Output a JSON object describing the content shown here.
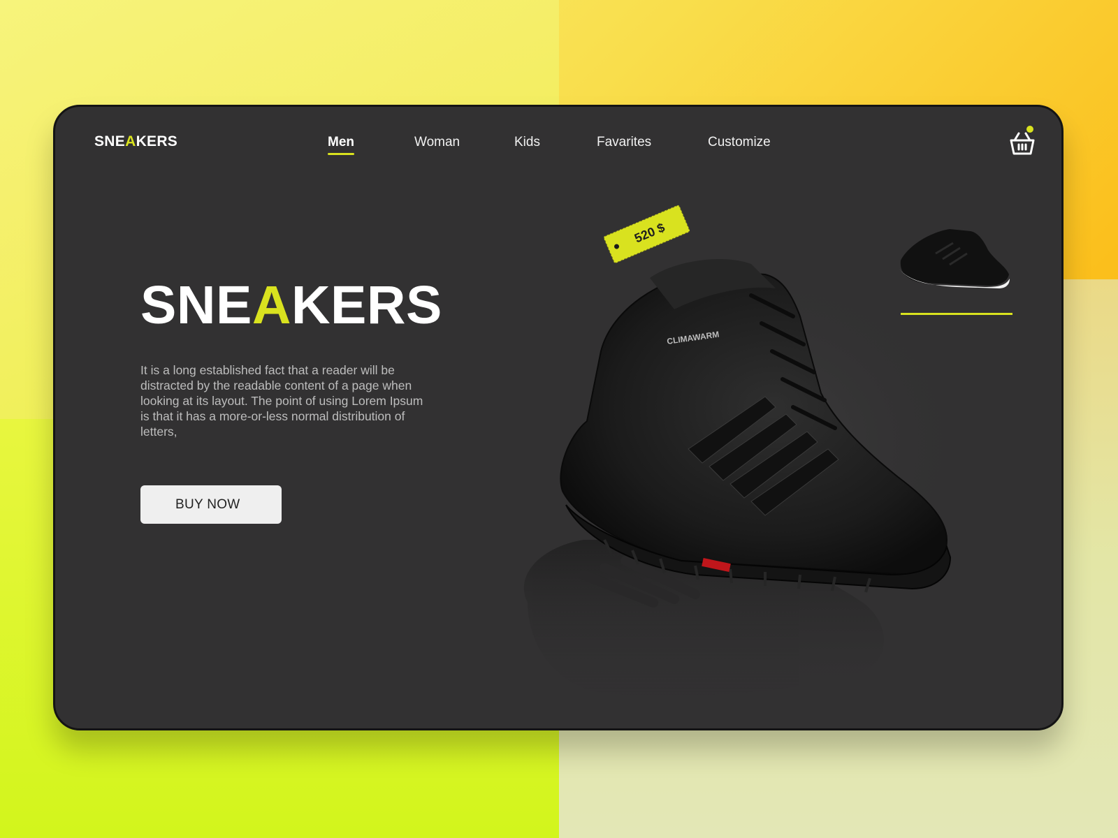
{
  "brand": {
    "logo_pre": "SNE",
    "logo_accent": "A",
    "logo_post": "KERS"
  },
  "nav": {
    "items": [
      {
        "label": "Men",
        "active": true
      },
      {
        "label": "Woman",
        "active": false
      },
      {
        "label": "Kids",
        "active": false
      },
      {
        "label": "Favarites",
        "active": false
      },
      {
        "label": "Customize",
        "active": false
      }
    ]
  },
  "header": {
    "cart_icon": "basket-icon",
    "cart_badge": "notification-dot"
  },
  "hero": {
    "title_pre": "SNE",
    "title_accent": "A",
    "title_post": "KERS",
    "description": "It is a long established fact that a reader will be distracted by the readable content of a page when looking at its layout. The point of using Lorem Ipsum is that it has a more-or-less normal distribution of letters,",
    "cta_label": "BUY NOW"
  },
  "product": {
    "price": "520 $",
    "image": "black-high-top-sneaker",
    "thumbnail": "black-running-sneaker"
  },
  "colors": {
    "accent": "#d9e21f",
    "card_bg": "#323132",
    "text": "#ffffff",
    "muted_text": "#bdbdbd",
    "button_bg": "#efefef"
  }
}
